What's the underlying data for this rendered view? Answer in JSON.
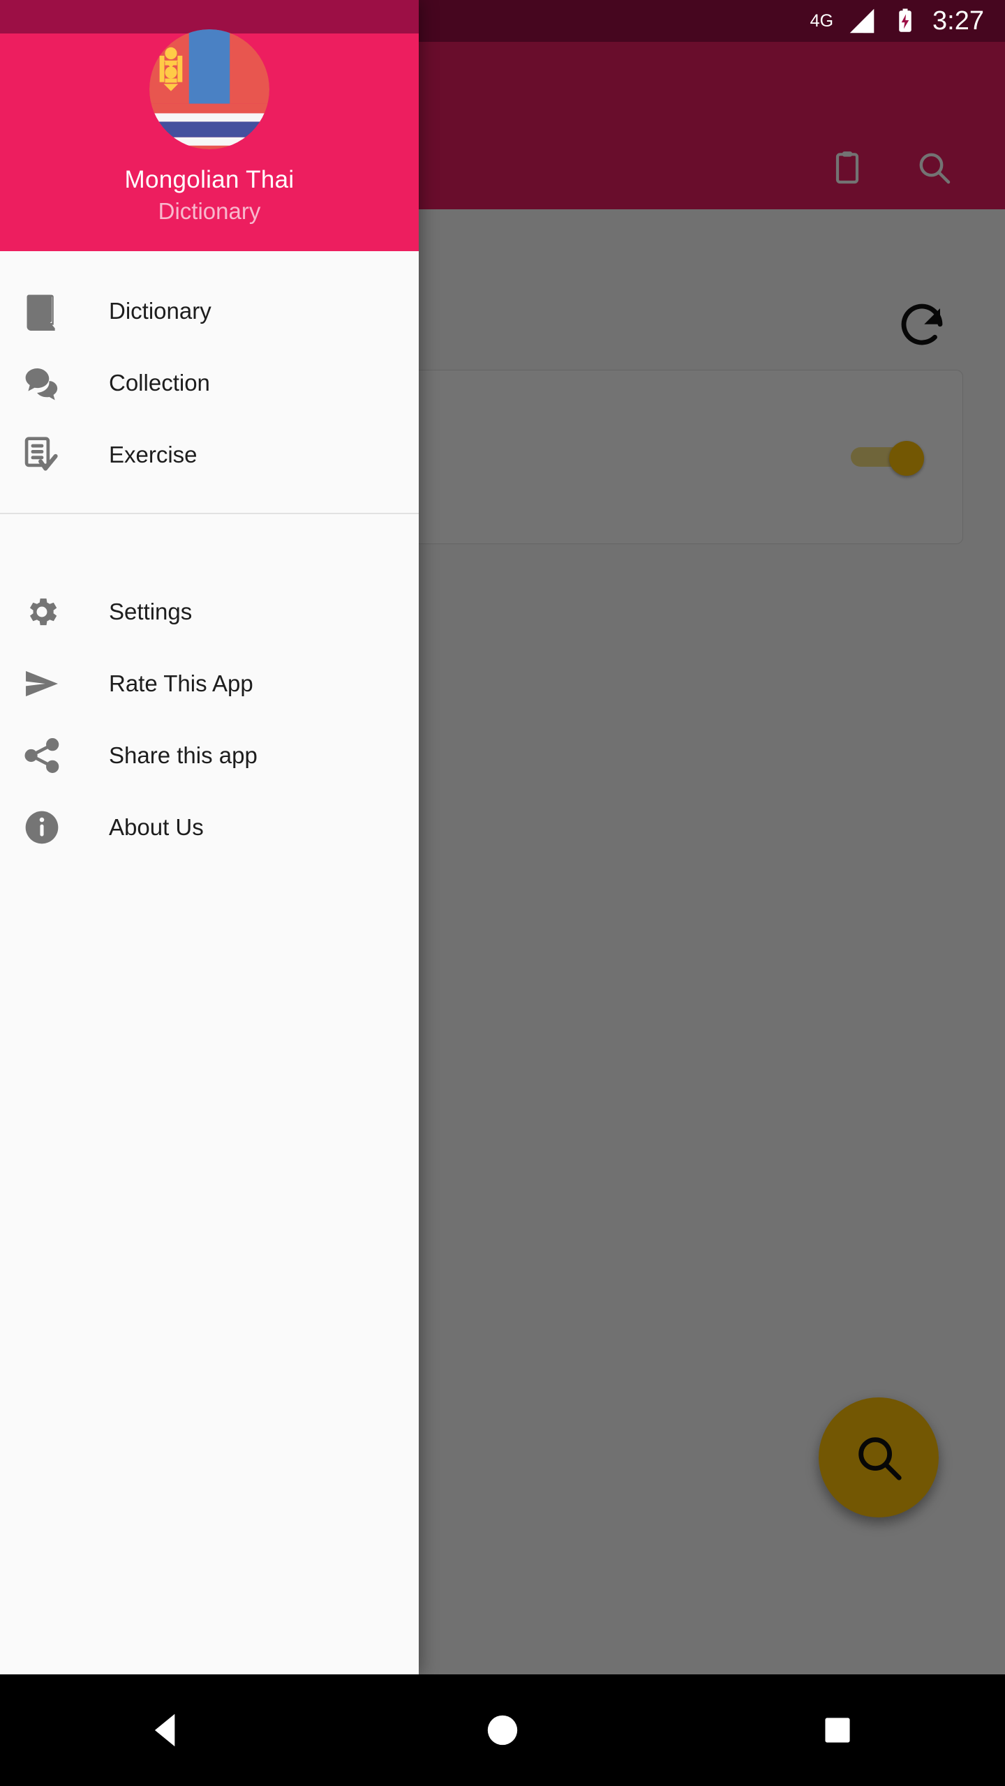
{
  "status_bar": {
    "network_label": "4G",
    "time": "3:27",
    "battery_icon": "battery-charging-icon",
    "signal_icon": "signal-bars-icon"
  },
  "app": {
    "appbar_actions": [
      {
        "name": "clipboard-icon",
        "label": "Clipboard"
      },
      {
        "name": "search-icon",
        "label": "Search"
      }
    ],
    "refresh_icon": "refresh-icon",
    "card_toggle_state": "on",
    "fab": {
      "icon": "search-icon",
      "label": "Search"
    }
  },
  "drawer": {
    "avatar": {
      "name": "mongolian-thai-flag-avatar",
      "colors": {
        "mongolia_red": "#e8564f",
        "mongolia_blue": "#4a81c4",
        "soyombo_gold": "#ffcb47",
        "thai_white": "#f7f7f7",
        "thai_blue": "#44509e"
      }
    },
    "title": "Mongolian  Thai",
    "subtitle": "Dictionary",
    "items_primary": [
      {
        "icon": "book-icon",
        "label": "Dictionary"
      },
      {
        "icon": "chat-bubbles-icon",
        "label": "Collection"
      },
      {
        "icon": "task-check-icon",
        "label": "Exercise"
      }
    ],
    "items_secondary": [
      {
        "icon": "gear-icon",
        "label": "Settings"
      },
      {
        "icon": "send-arrow-icon",
        "label": "Rate This App"
      },
      {
        "icon": "share-icon",
        "label": "Share this app"
      },
      {
        "icon": "info-circle-icon",
        "label": "About Us"
      }
    ]
  },
  "navigation_bar": {
    "back": "back-triangle-icon",
    "home": "home-circle-icon",
    "recents": "recents-square-icon"
  },
  "colors": {
    "primary": "#ed1e5f",
    "primary_dark": "#9c0f45",
    "accent": "#ffc107",
    "drawer_bg": "#fafafa",
    "icon_grey": "#757575"
  }
}
